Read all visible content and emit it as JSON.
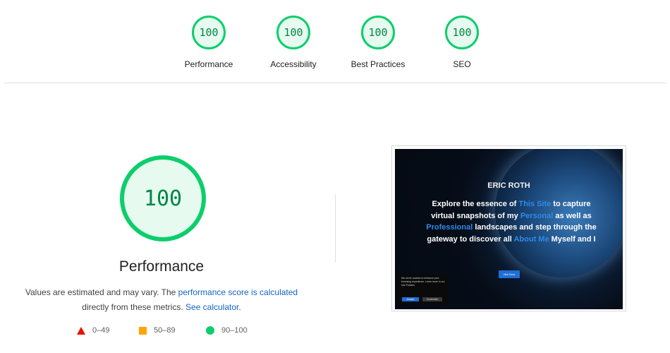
{
  "summary": {
    "gauges": [
      {
        "score": "100",
        "label": "Performance"
      },
      {
        "score": "100",
        "label": "Accessibility"
      },
      {
        "score": "100",
        "label": "Best Practices"
      },
      {
        "score": "100",
        "label": "SEO"
      }
    ]
  },
  "performance": {
    "score": "100",
    "title": "Performance",
    "desc_prefix": "Values are estimated and may vary. The ",
    "desc_link1": "performance score is calculated",
    "desc_middle": " directly from these metrics. ",
    "desc_link2": "See calculator",
    "desc_suffix": "."
  },
  "legend": [
    {
      "range": "0–49",
      "color": "#eb0f00"
    },
    {
      "range": "50–89",
      "color": "#ffa400"
    },
    {
      "range": "90–100",
      "color": "#0cce6b"
    }
  ],
  "preview": {
    "name": "ERIC ROTH",
    "t1": "Explore the essence of ",
    "hl1": "This Site",
    "t2": " to capture virtual snapshots of my ",
    "hl2": "Personal",
    "t3": " as well as ",
    "hl3": "Professional",
    "t4": " landscapes and step through the gateway to discover all ",
    "hl4": "About Me",
    "t5": " Myself and I",
    "button": "Hire Now",
    "cookie_text": "We serve cookies to enhance your browsing experience. Learn more in our Info Policies",
    "cookie_accept": "Accept",
    "cookie_more": "Customize"
  },
  "colors": {
    "pass": "#0cce6b",
    "pass_text": "#018642",
    "link": "#1565c0"
  }
}
